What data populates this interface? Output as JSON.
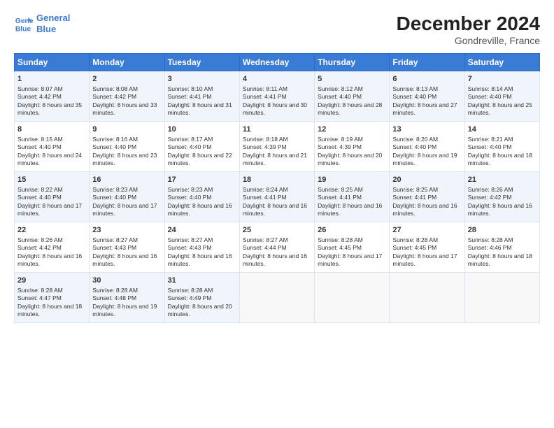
{
  "header": {
    "logo_line1": "General",
    "logo_line2": "Blue",
    "main_title": "December 2024",
    "subtitle": "Gondreville, France"
  },
  "days_of_week": [
    "Sunday",
    "Monday",
    "Tuesday",
    "Wednesday",
    "Thursday",
    "Friday",
    "Saturday"
  ],
  "weeks": [
    [
      {
        "day": "1",
        "sunrise": "Sunrise: 8:07 AM",
        "sunset": "Sunset: 4:42 PM",
        "daylight": "Daylight: 8 hours and 35 minutes."
      },
      {
        "day": "2",
        "sunrise": "Sunrise: 8:08 AM",
        "sunset": "Sunset: 4:42 PM",
        "daylight": "Daylight: 8 hours and 33 minutes."
      },
      {
        "day": "3",
        "sunrise": "Sunrise: 8:10 AM",
        "sunset": "Sunset: 4:41 PM",
        "daylight": "Daylight: 8 hours and 31 minutes."
      },
      {
        "day": "4",
        "sunrise": "Sunrise: 8:11 AM",
        "sunset": "Sunset: 4:41 PM",
        "daylight": "Daylight: 8 hours and 30 minutes."
      },
      {
        "day": "5",
        "sunrise": "Sunrise: 8:12 AM",
        "sunset": "Sunset: 4:40 PM",
        "daylight": "Daylight: 8 hours and 28 minutes."
      },
      {
        "day": "6",
        "sunrise": "Sunrise: 8:13 AM",
        "sunset": "Sunset: 4:40 PM",
        "daylight": "Daylight: 8 hours and 27 minutes."
      },
      {
        "day": "7",
        "sunrise": "Sunrise: 8:14 AM",
        "sunset": "Sunset: 4:40 PM",
        "daylight": "Daylight: 8 hours and 25 minutes."
      }
    ],
    [
      {
        "day": "8",
        "sunrise": "Sunrise: 8:15 AM",
        "sunset": "Sunset: 4:40 PM",
        "daylight": "Daylight: 8 hours and 24 minutes."
      },
      {
        "day": "9",
        "sunrise": "Sunrise: 8:16 AM",
        "sunset": "Sunset: 4:40 PM",
        "daylight": "Daylight: 8 hours and 23 minutes."
      },
      {
        "day": "10",
        "sunrise": "Sunrise: 8:17 AM",
        "sunset": "Sunset: 4:40 PM",
        "daylight": "Daylight: 8 hours and 22 minutes."
      },
      {
        "day": "11",
        "sunrise": "Sunrise: 8:18 AM",
        "sunset": "Sunset: 4:39 PM",
        "daylight": "Daylight: 8 hours and 21 minutes."
      },
      {
        "day": "12",
        "sunrise": "Sunrise: 8:19 AM",
        "sunset": "Sunset: 4:39 PM",
        "daylight": "Daylight: 8 hours and 20 minutes."
      },
      {
        "day": "13",
        "sunrise": "Sunrise: 8:20 AM",
        "sunset": "Sunset: 4:40 PM",
        "daylight": "Daylight: 8 hours and 19 minutes."
      },
      {
        "day": "14",
        "sunrise": "Sunrise: 8:21 AM",
        "sunset": "Sunset: 4:40 PM",
        "daylight": "Daylight: 8 hours and 18 minutes."
      }
    ],
    [
      {
        "day": "15",
        "sunrise": "Sunrise: 8:22 AM",
        "sunset": "Sunset: 4:40 PM",
        "daylight": "Daylight: 8 hours and 17 minutes."
      },
      {
        "day": "16",
        "sunrise": "Sunrise: 8:23 AM",
        "sunset": "Sunset: 4:40 PM",
        "daylight": "Daylight: 8 hours and 17 minutes."
      },
      {
        "day": "17",
        "sunrise": "Sunrise: 8:23 AM",
        "sunset": "Sunset: 4:40 PM",
        "daylight": "Daylight: 8 hours and 16 minutes."
      },
      {
        "day": "18",
        "sunrise": "Sunrise: 8:24 AM",
        "sunset": "Sunset: 4:41 PM",
        "daylight": "Daylight: 8 hours and 16 minutes."
      },
      {
        "day": "19",
        "sunrise": "Sunrise: 8:25 AM",
        "sunset": "Sunset: 4:41 PM",
        "daylight": "Daylight: 8 hours and 16 minutes."
      },
      {
        "day": "20",
        "sunrise": "Sunrise: 8:25 AM",
        "sunset": "Sunset: 4:41 PM",
        "daylight": "Daylight: 8 hours and 16 minutes."
      },
      {
        "day": "21",
        "sunrise": "Sunrise: 8:26 AM",
        "sunset": "Sunset: 4:42 PM",
        "daylight": "Daylight: 8 hours and 16 minutes."
      }
    ],
    [
      {
        "day": "22",
        "sunrise": "Sunrise: 8:26 AM",
        "sunset": "Sunset: 4:42 PM",
        "daylight": "Daylight: 8 hours and 16 minutes."
      },
      {
        "day": "23",
        "sunrise": "Sunrise: 8:27 AM",
        "sunset": "Sunset: 4:43 PM",
        "daylight": "Daylight: 8 hours and 16 minutes."
      },
      {
        "day": "24",
        "sunrise": "Sunrise: 8:27 AM",
        "sunset": "Sunset: 4:43 PM",
        "daylight": "Daylight: 8 hours and 16 minutes."
      },
      {
        "day": "25",
        "sunrise": "Sunrise: 8:27 AM",
        "sunset": "Sunset: 4:44 PM",
        "daylight": "Daylight: 8 hours and 16 minutes."
      },
      {
        "day": "26",
        "sunrise": "Sunrise: 8:28 AM",
        "sunset": "Sunset: 4:45 PM",
        "daylight": "Daylight: 8 hours and 17 minutes."
      },
      {
        "day": "27",
        "sunrise": "Sunrise: 8:28 AM",
        "sunset": "Sunset: 4:45 PM",
        "daylight": "Daylight: 8 hours and 17 minutes."
      },
      {
        "day": "28",
        "sunrise": "Sunrise: 8:28 AM",
        "sunset": "Sunset: 4:46 PM",
        "daylight": "Daylight: 8 hours and 18 minutes."
      }
    ],
    [
      {
        "day": "29",
        "sunrise": "Sunrise: 8:28 AM",
        "sunset": "Sunset: 4:47 PM",
        "daylight": "Daylight: 8 hours and 18 minutes."
      },
      {
        "day": "30",
        "sunrise": "Sunrise: 8:28 AM",
        "sunset": "Sunset: 4:48 PM",
        "daylight": "Daylight: 8 hours and 19 minutes."
      },
      {
        "day": "31",
        "sunrise": "Sunrise: 8:28 AM",
        "sunset": "Sunset: 4:49 PM",
        "daylight": "Daylight: 8 hours and 20 minutes."
      },
      null,
      null,
      null,
      null
    ]
  ]
}
